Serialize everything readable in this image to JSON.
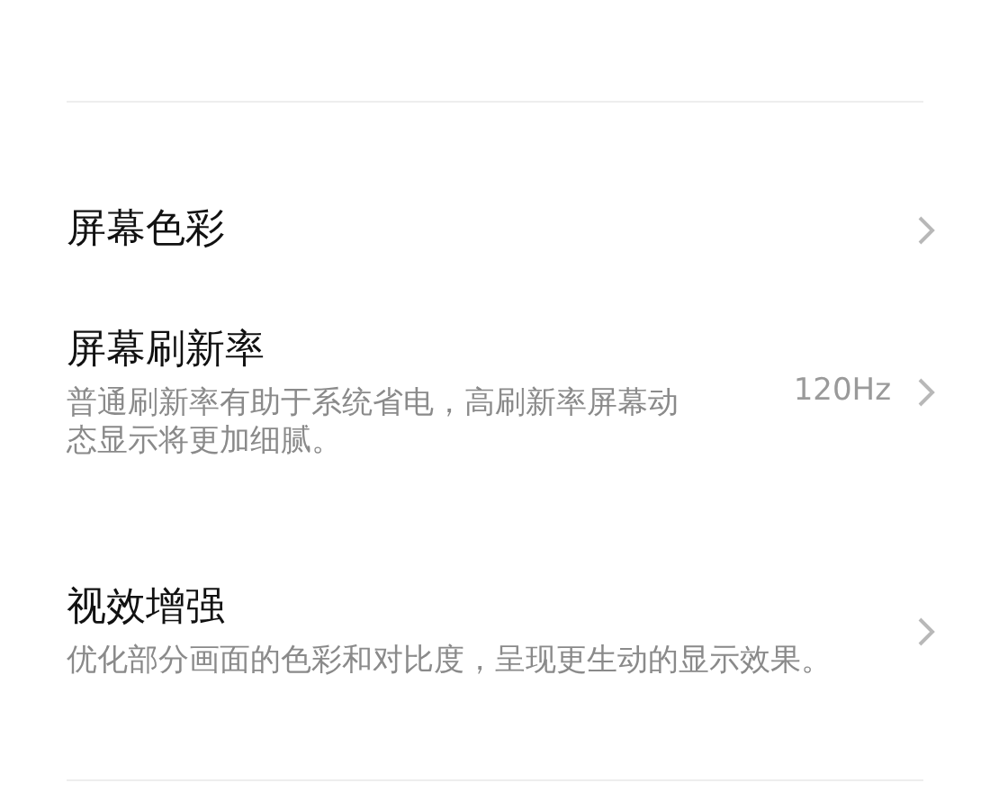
{
  "items": [
    {
      "title": "屏幕色彩"
    },
    {
      "title": "屏幕刷新率",
      "description": "普通刷新率有助于系统省电，高刷新率屏幕动态显示将更加细腻。",
      "value": "120Hz"
    },
    {
      "title": "视效增强",
      "description": "优化部分画面的色彩和对比度，呈现更生动的显示效果。"
    }
  ]
}
